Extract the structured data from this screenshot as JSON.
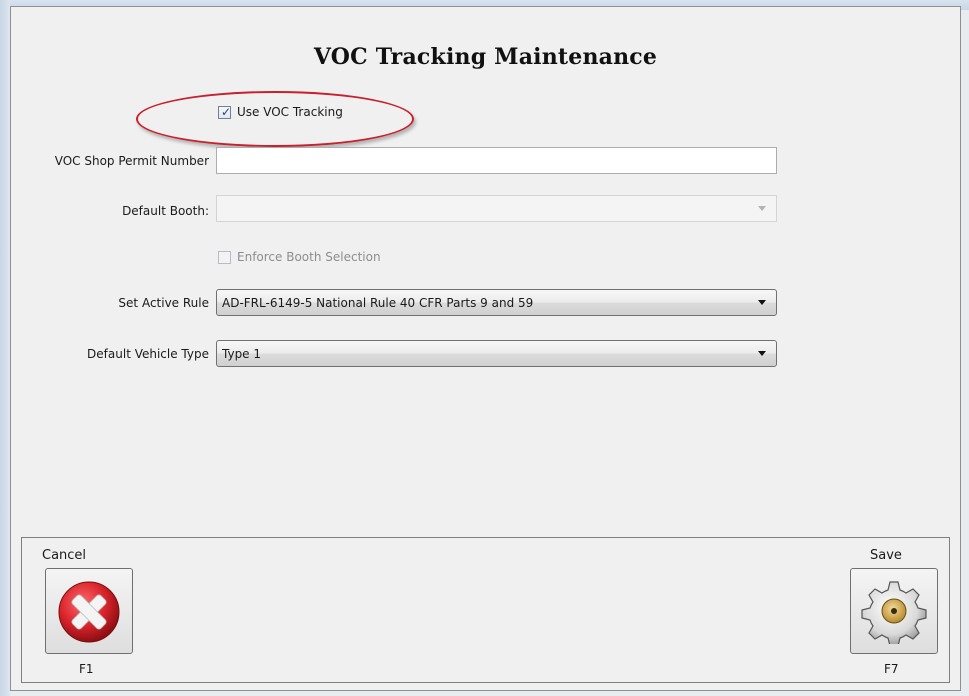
{
  "window": {
    "title": "VOC Tracking Maintenance"
  },
  "form": {
    "use_voc_tracking": {
      "label": "Use VOC Tracking",
      "checked": true
    },
    "permit_number": {
      "label": "VOC Shop Permit Number",
      "value": ""
    },
    "default_booth": {
      "label": "Default Booth:",
      "value": ""
    },
    "enforce_booth": {
      "label": "Enforce Booth Selection",
      "checked": false
    },
    "active_rule": {
      "label": "Set Active Rule",
      "value": "AD-FRL-6149-5 National Rule 40 CFR Parts 9 and 59"
    },
    "vehicle_type": {
      "label": "Default Vehicle Type",
      "value": "Type 1"
    }
  },
  "footer": {
    "cancel": {
      "label": "Cancel",
      "key": "F1",
      "icon": "cancel-x-icon"
    },
    "save": {
      "label": "Save",
      "key": "F7",
      "icon": "gear-icon"
    }
  },
  "colors": {
    "annotation_ellipse": "#c8202c",
    "cancel_red": "#d8232a"
  }
}
